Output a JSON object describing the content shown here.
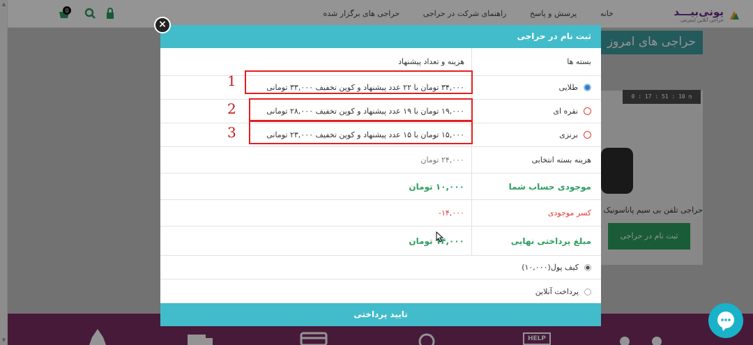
{
  "site": {
    "logo_name": "یونی‌بیـــد",
    "logo_tagline": "حراجی آنلاین اینترنتی",
    "nav": [
      "خانه",
      "پرسش و پاسخ",
      "راهنمای شرکت در حراجی",
      "حراجی های برگزار شده"
    ],
    "cart_count": "0",
    "hero_title": "حراجی های امروز",
    "timer": "0 : 17 : 51 : 10",
    "product_name": "حراجی تلفن بی سیم پاناسونیک",
    "product_register_button": "ثبت نام در حراجی",
    "footer_help": "HELP"
  },
  "modal": {
    "title": "ثبت نام در حراجی",
    "close_label": "×",
    "header_packages": "بسته ها",
    "header_cost": "هزینه و تعداد پیشنهاد",
    "packages": [
      {
        "name": "طلایی",
        "desc": "۳۴,۰۰۰ تومان با ۲۲ عدد پیشنهاد و کوپن تخفیف ۳۳,۰۰۰ تومانی",
        "selected": true,
        "annotation": "1"
      },
      {
        "name": "نقره ای",
        "desc": "۱۹,۰۰۰ تومان با ۱۹ عدد پیشنهاد و کوپن تخفیف ۲۸,۰۰۰ تومانی",
        "selected": false,
        "annotation": "2"
      },
      {
        "name": "برنزی",
        "desc": "۱۵,۰۰۰ تومان با ۱۵ عدد پیشنهاد و کوپن تخفیف ۲۳,۰۰۰ تومانی",
        "selected": false,
        "annotation": "3"
      }
    ],
    "selected_cost_label": "هزینه بسته انتخابی",
    "selected_cost_value": "۲۴,۰۰۰ تومان",
    "balance_label": "موجودی حساب شما",
    "balance_value": "۱۰,۰۰۰ تومان",
    "deduct_label": "کسر موجودی",
    "deduct_value": "۱۴,۰۰۰-",
    "final_label": "مبلغ پرداختی نهایی",
    "final_value": "۱۴,۰۰۰ تومان",
    "payment_options": [
      {
        "label": "کیف پول(۱۰,۰۰۰)",
        "selected": true
      },
      {
        "label": "پرداخت آنلاین",
        "selected": false
      }
    ],
    "confirm_button": "تایید پرداختی"
  },
  "colors": {
    "accent": "#42bccb",
    "green": "#2e9f5f",
    "red": "#e53935",
    "annotation_red": "#e41e1e",
    "footer_purple": "#7a2e65"
  },
  "icons": [
    "lock-icon",
    "search-icon",
    "cart-icon",
    "close-icon",
    "clock-icon",
    "chat-icon",
    "help-icon"
  ]
}
